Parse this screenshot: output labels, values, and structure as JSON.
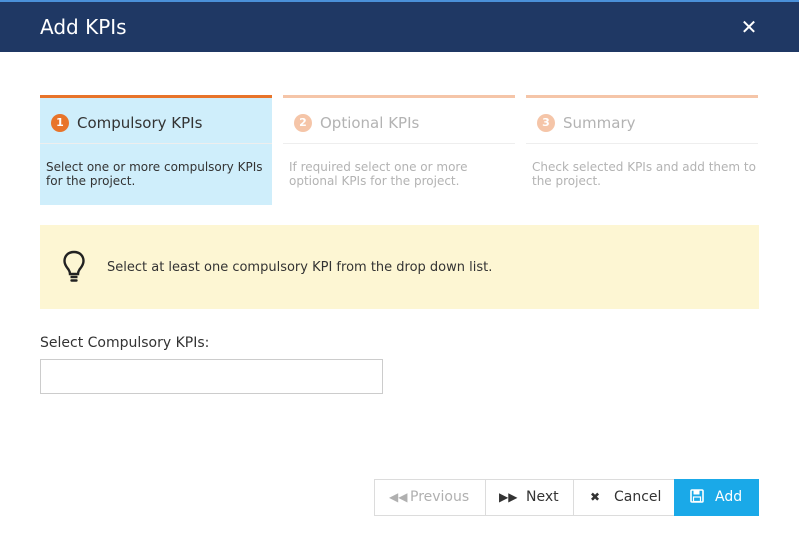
{
  "dialog": {
    "title": "Add KPIs",
    "close_icon": "close-icon"
  },
  "steps": [
    {
      "number": "1",
      "label": "Compulsory KPIs",
      "description": "Select one or more compulsory KPIs for the project.",
      "state": "active"
    },
    {
      "number": "2",
      "label": "Optional KPIs",
      "description": "If required select one or more optional KPIs for the project.",
      "state": "inactive"
    },
    {
      "number": "3",
      "label": "Summary",
      "description": "Check selected KPIs and add them to the project.",
      "state": "inactive"
    }
  ],
  "hint": {
    "icon": "lightbulb-icon",
    "text": "Select at least one compulsory KPI from the drop down list."
  },
  "form": {
    "label": "Select Compulsory KPIs:",
    "value": ""
  },
  "buttons": {
    "previous": {
      "label": "Previous",
      "icon": "double-left-icon",
      "enabled": false
    },
    "next": {
      "label": "Next",
      "icon": "double-right-icon"
    },
    "cancel": {
      "label": "Cancel",
      "icon": "close-icon"
    },
    "add": {
      "label": "Add",
      "icon": "save-icon"
    }
  },
  "colors": {
    "header": "#1f3864",
    "accent_active": "#e8742a",
    "accent_inactive": "#f5c5a8",
    "active_step_bg": "#cfeefb",
    "hint_bg": "#fdf6d3",
    "primary_button": "#1aa9e8"
  }
}
